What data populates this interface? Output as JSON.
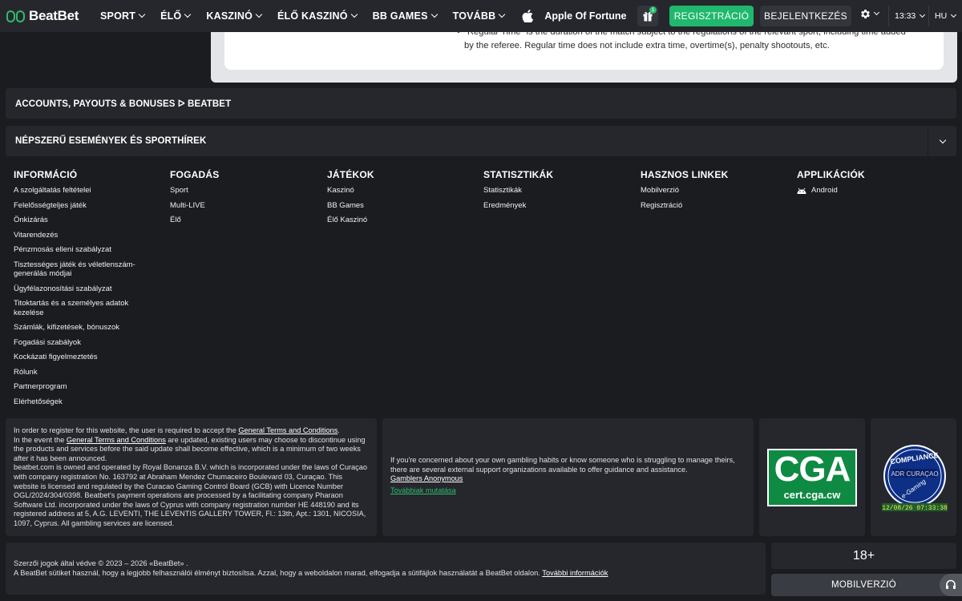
{
  "header": {
    "logo_text": "BeatBet",
    "nav": [
      "SPORT",
      "ÉLŐ",
      "KASZINÓ",
      "ÉLŐ KASZINÓ",
      "BB GAMES",
      "TOVÁBB"
    ],
    "promo_label": "Apple Of Fortune",
    "gift_count": "1",
    "register_label": "REGISZTRÁCIÓ",
    "login_label": "BEJELENTKEZÉS",
    "time": "13:33",
    "language": "HU"
  },
  "rules": {
    "bullet": "•",
    "text": "\"Regular Time\" is the duration of the match subject to the regulations of the relevant sport, including time added by the referee. Regular time does not include extra time, overtime(s), penalty shootouts, etc."
  },
  "accordions": {
    "accounts": "ACCOUNTS, PAYOUTS & BONUSES ᐅ BEATBET",
    "popular": "NÉPSZERŰ ESEMÉNYEK ÉS SPORTHÍREK"
  },
  "footer": {
    "columns": [
      {
        "title": "INFORMÁCIÓ",
        "links": [
          "A szolgáltatás feltételei",
          "Felelősségteljes játék",
          "Önkizárás",
          "Vitarendezés",
          "Pénzmosás elleni szabályzat",
          "Tisztességes játék és véletlenszám-generálás módjai",
          "Ügyfélazonosítási szabályzat",
          "Titoktartás és a személyes adatok kezelése",
          "Számlák, kifizetések, bónuszok",
          "Fogadási szabályok",
          "Kockázati figyelmeztetés",
          "Rólunk",
          "Partnerprogram",
          "Elérhetőségek"
        ]
      },
      {
        "title": "FOGADÁS",
        "links": [
          "Sport",
          "Multi-LIVE",
          "Élő"
        ]
      },
      {
        "title": "JÁTÉKOK",
        "links": [
          "Kaszinó",
          "BB Games",
          "Élő Kaszinó"
        ]
      },
      {
        "title": "STATISZTIKÁK",
        "links": [
          "Statisztikák",
          "Eredmények"
        ]
      },
      {
        "title": "HASZNOS LINKEK",
        "links": [
          "Mobilverzió",
          "Regisztráció"
        ]
      },
      {
        "title": "APPLIKÁCIÓK",
        "links": [
          "Android"
        ]
      }
    ]
  },
  "legal": {
    "p1_before": "In order to register for this website, the user is required to accept the ",
    "p1_link": "General Terms and Conditions",
    "p1_after": ".",
    "p2_before": "In the event the ",
    "p2_link": "General Terms and Conditions",
    "p2_after": " are updated, existing users may choose to discontinue using the products and services before the said update shall become effective, which is a minimum of two weeks after it has been announced.",
    "p3": "beatbet.com is owned and operated by Royal Bonanza B.V. which is incorporated under the laws of Curaçao with company registration No. 163792 at Abraham Mendez Chumaceiro Boulevard 03, Curaçao. This website is licensed and regulated by the Curacao Gaming Control Board (GCB) with Licence Number OGL/2024/304/0398. Beatbet's payment operations are processed by a facilitating company Pharaon Software Ltd. incorporated under the laws of Cyprus with company registration number HE 448190 and its registered address at 5, A.G. LEVENTI, THE LEVENTIS GALLERY TOWER, Fl.: 13th, Apt.: 1301, NICOSIA, 1097, Cyprus. All gambling services are licensed."
  },
  "support_block": {
    "text": "If you're concerned about your own gambling habits or know someone who is struggling to manage theirs, there are several external support organizations available to offer guidance and assistance.",
    "link": "Gamblers Anonymous",
    "more": "Továbbiak mutatása"
  },
  "badges": {
    "cga_big": "CGA",
    "cga_small": "cert.cga.cw",
    "seal_top": "COMPLIANCE",
    "seal_mid": "ADR CURAÇAO",
    "seal_bottom": "e-Gaming",
    "seal_date": "12/08/26 07:33:38"
  },
  "bottom": {
    "copyright": "Szerzői jogok által védve © 2023 – 2026 «BeatBet» .",
    "cookies": "A BeatBet sütiket használ, hogy a legjobb felhasználói élményt biztosítsa. Azzal, hogy a weboldalon marad, elfogadja a sütifájlok használatát a BeatBet oldalon. ",
    "cookies_link": "További információk",
    "age": "18+",
    "mobile_label": "MOBILVERZIÓ"
  },
  "colors": {
    "accent": "#1fb86c",
    "background": "#1b1c20",
    "panel": "#26272d"
  }
}
